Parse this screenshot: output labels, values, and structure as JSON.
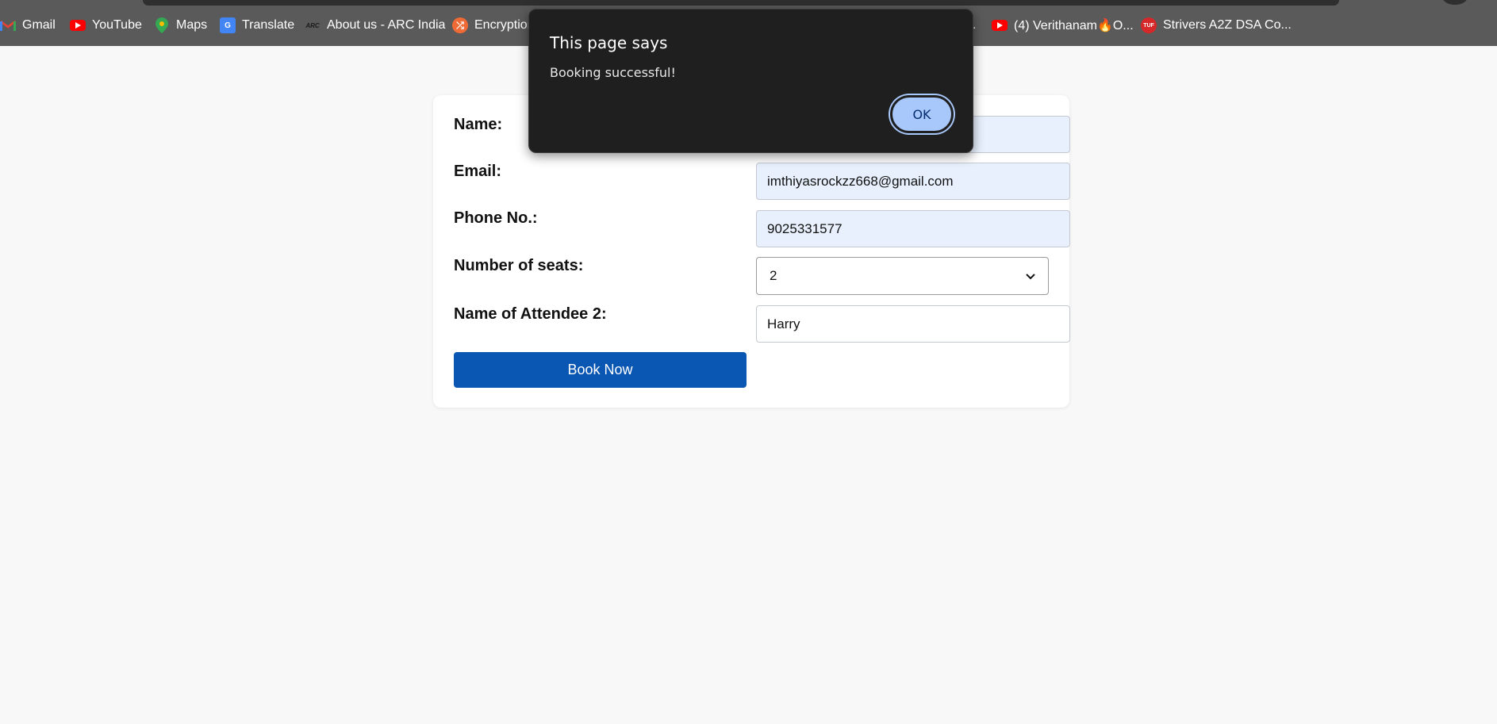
{
  "bookmarks": [
    {
      "label": "Gmail",
      "icon": "gmail-icon"
    },
    {
      "label": "YouTube",
      "icon": "youtube-icon"
    },
    {
      "label": "Maps",
      "icon": "maps-icon"
    },
    {
      "label": "Translate",
      "icon": "translate-icon"
    },
    {
      "label": "About us - ARC India",
      "icon": "arc-icon"
    },
    {
      "label": "Encryption",
      "icon": "shuffle-icon"
    },
    {
      "label": ".",
      "icon": ""
    },
    {
      "label": "(4) Verithanam🔥O...",
      "icon": "youtube-icon"
    },
    {
      "label": "Strivers A2Z DSA Co...",
      "icon": "tuf-icon"
    }
  ],
  "form": {
    "name_label": "Name:",
    "name_value": "",
    "email_label": "Email:",
    "email_value": "imthiyasrockzz668@gmail.com",
    "phone_label": "Phone No.:",
    "phone_value": "9025331577",
    "seats_label": "Number of seats:",
    "seats_value": "2",
    "attendee_label": "Name of Attendee 2:",
    "attendee_value": "Harry",
    "submit_label": "Book Now"
  },
  "dialog": {
    "title": "This page says",
    "message": "Booking successful!",
    "ok_label": "OK"
  },
  "colors": {
    "primary_button": "#0a56b3",
    "dialog_bg": "#1f1f1f",
    "ok_button": "#a8c7fa",
    "autofill_bg": "#e8f0fe"
  }
}
